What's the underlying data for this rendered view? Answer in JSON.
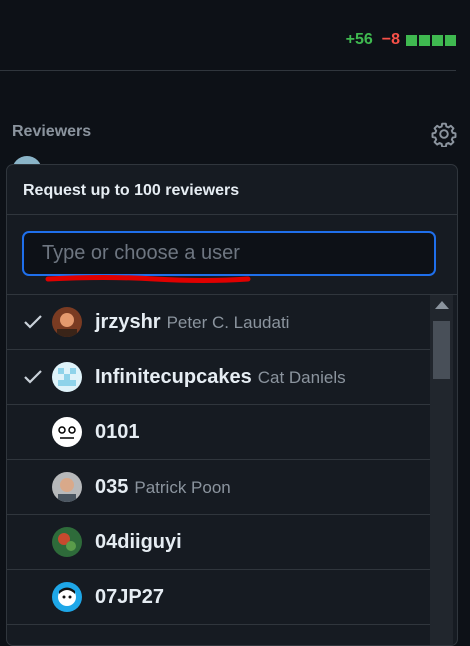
{
  "diffstat": {
    "additions": "+56",
    "deletions": "−8",
    "blocks": 4
  },
  "sidebar": {
    "reviewers_label": "Reviewers",
    "settings_icon": "gear-icon"
  },
  "popover": {
    "title": "Request up to 100 reviewers",
    "search": {
      "placeholder": "Type or choose a user",
      "value": ""
    },
    "users": [
      {
        "login": "jrzyshr",
        "name": "Peter C. Laudati",
        "selected": true
      },
      {
        "login": "Infinitecupcakes",
        "name": "Cat Daniels",
        "selected": true
      },
      {
        "login": "0101",
        "name": "",
        "selected": false
      },
      {
        "login": "035",
        "name": "Patrick Poon",
        "selected": false
      },
      {
        "login": "04diiguyi",
        "name": "",
        "selected": false
      },
      {
        "login": "07JP27",
        "name": "",
        "selected": false
      }
    ]
  },
  "colors": {
    "accent": "#1f6feb",
    "add": "#3fb950",
    "del": "#f85149",
    "annotation": "#e00000"
  }
}
